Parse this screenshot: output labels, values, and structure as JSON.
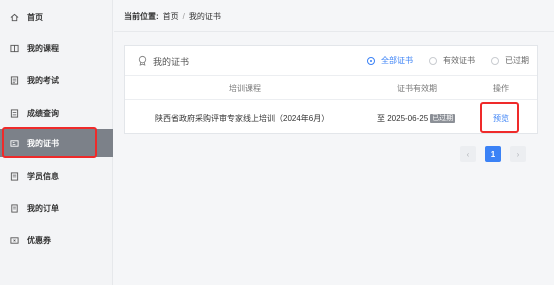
{
  "sidebar": {
    "items": [
      {
        "label": "首页",
        "icon": "home-icon"
      },
      {
        "label": "我的课程",
        "icon": "book-icon"
      },
      {
        "label": "我的考试",
        "icon": "exam-icon"
      },
      {
        "label": "成绩查询",
        "icon": "score-icon"
      },
      {
        "label": "我的证书",
        "icon": "certificate-icon",
        "active": true
      },
      {
        "label": "学员信息",
        "icon": "profile-icon"
      },
      {
        "label": "我的订单",
        "icon": "order-icon"
      },
      {
        "label": "优惠券",
        "icon": "coupon-icon"
      }
    ]
  },
  "breadcrumb": {
    "prefix": "当前位置:",
    "home": "首页",
    "separator": "/",
    "current": "我的证书"
  },
  "card": {
    "title": "我的证书",
    "title_icon": "certificate-icon",
    "filters": [
      {
        "label": "全部证书",
        "checked": true
      },
      {
        "label": "有效证书",
        "checked": false
      },
      {
        "label": "已过期",
        "checked": false
      }
    ]
  },
  "table": {
    "columns": [
      "培训课程",
      "证书有效期",
      "操作"
    ],
    "rows": [
      {
        "course": "陕西省政府采购评审专家线上培训（2024年6月）",
        "validity": "至 2025-06-25",
        "badge": "已过期",
        "action": "预览"
      }
    ]
  },
  "pagination": {
    "prev": "‹",
    "current": "1",
    "next": "›"
  },
  "colors": {
    "accent": "#3b82f6",
    "active_nav_bg": "#7c8189",
    "highlight": "#ef2a2a"
  }
}
